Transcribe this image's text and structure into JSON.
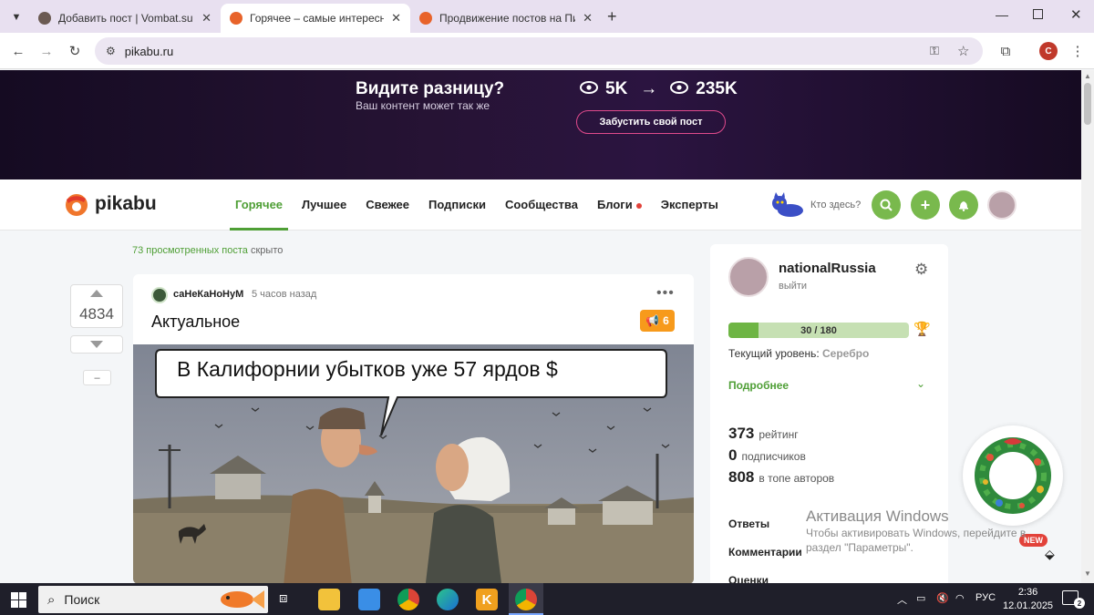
{
  "browser": {
    "tabs": [
      {
        "title": "Добавить пост | Vombat.su",
        "icon": "vombat-favicon",
        "color": "#6b5a52"
      },
      {
        "title": "Горячее – самые интересные",
        "icon": "pikabu-favicon",
        "color": "#e8632a"
      },
      {
        "title": "Продвижение постов на Пика",
        "icon": "pikabu-favicon",
        "color": "#e8632a"
      }
    ],
    "url": "pikabu.ru",
    "profile_letter": "C"
  },
  "banner": {
    "headline": "Видите разницу?",
    "subline": "Ваш контент может так же",
    "stat_from": "5K",
    "stat_to": "235K",
    "cta": "Забустить свой пост"
  },
  "site": {
    "logo": "pikabu",
    "nav": [
      "Горячее",
      "Лучшее",
      "Свежее",
      "Подписки",
      "Сообщества",
      "Блоги",
      "Эксперты"
    ],
    "who_label": "Кто здесь?",
    "accent": "#4f9f36"
  },
  "feed": {
    "hidden_count_text": "73 просмотренных поста",
    "hidden_suffix": "скрыто",
    "vote_count": "4834",
    "collapse": "–",
    "post": {
      "author": "саНеКаНоНуМ",
      "time": "5 часов назад",
      "title": "Актуальное",
      "badge": "6",
      "caption": "В Калифорнии убытков уже 57  ярдов $"
    }
  },
  "sidebar": {
    "username": "nationalRussia",
    "logout": "выйти",
    "progress_text": "30 / 180",
    "progress_value": 0.1667,
    "level_label": "Текущий уровень:",
    "level_value": "Серебро",
    "more": "Подробнее",
    "stats": [
      {
        "value": "373",
        "label": "рейтинг"
      },
      {
        "value": "0",
        "label": "подписчиков"
      },
      {
        "value": "808",
        "label": "в топе авторов"
      }
    ],
    "items": [
      "Ответы",
      "Комментарии",
      "Оценки"
    ],
    "new_badge": "NEW"
  },
  "activation": {
    "title": "Активация Windows",
    "line1": "Чтобы активировать Windows, перейдите в",
    "line2": "раздел \"Параметры\"."
  },
  "taskbar": {
    "search": "Поиск",
    "lang": "РУС",
    "time": "2:36",
    "date": "12.01.2025"
  }
}
